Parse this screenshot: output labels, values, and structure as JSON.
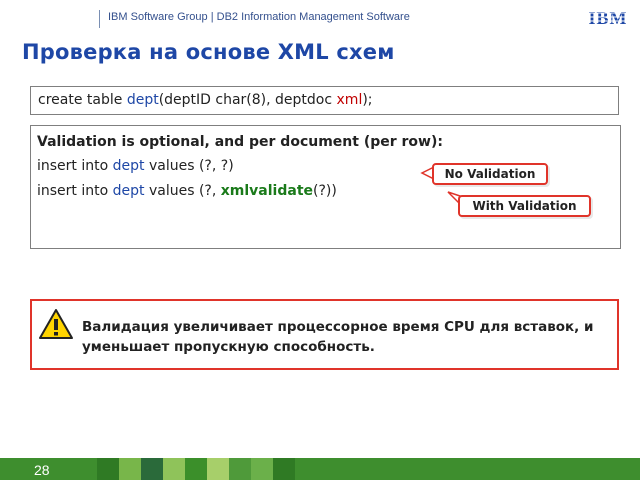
{
  "header": {
    "text": "IBM Software Group  |  DB2 Information Management Software",
    "logo_text": "IBM"
  },
  "title": "Проверка на основе XML схем",
  "create_box": {
    "prefix": "create table ",
    "table": "dept",
    "middle": "(deptID char(8),  deptdoc ",
    "type": "xml",
    "suffix": ");"
  },
  "validation_box": {
    "line1": "Validation is optional, and per document (per row):",
    "line2_prefix": "insert into ",
    "line2_table": "dept",
    "line2_suffix": " values (?, ?)",
    "line3_prefix": "insert into ",
    "line3_table": "dept",
    "line3_middle": " values (?, ",
    "line3_func": "xmlvalidate",
    "line3_suffix": "(?))"
  },
  "callouts": {
    "no_validation": "No Validation",
    "with_validation": "With Validation"
  },
  "warning": {
    "text": "Валидация увеличивает процессорное время CPU для вставок, и уменьшает пропускную способность."
  },
  "footer": {
    "page_number": "28"
  },
  "colors": {
    "title_blue": "#1e47a6",
    "accent_red": "#e0342a",
    "footer_green": "#3e8e2e"
  }
}
